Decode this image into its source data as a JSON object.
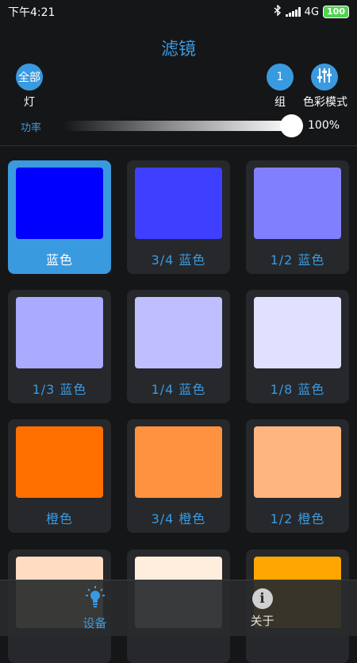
{
  "status_bar": {
    "time": "下午4:21",
    "network": "4G",
    "battery": "100"
  },
  "header": {
    "title": "滤镜"
  },
  "controls": {
    "all_button": "全部",
    "all_label": "灯",
    "group_button": "1",
    "group_label": "组",
    "color_mode_label": "色彩模式"
  },
  "power": {
    "label": "功率",
    "value_text": "100%",
    "level": 1.0
  },
  "filters": [
    {
      "label": "蓝色",
      "color": "#0000ff",
      "selected": true
    },
    {
      "label": "3/4 蓝色",
      "color": "#3f3fff",
      "selected": false
    },
    {
      "label": "1/2 蓝色",
      "color": "#8080ff",
      "selected": false
    },
    {
      "label": "1/3 蓝色",
      "color": "#aaaaff",
      "selected": false
    },
    {
      "label": "1/4 蓝色",
      "color": "#bfbfff",
      "selected": false
    },
    {
      "label": "1/8 蓝色",
      "color": "#e0e0ff",
      "selected": false
    },
    {
      "label": "橙色",
      "color": "#ff6f00",
      "selected": false
    },
    {
      "label": "3/4 橙色",
      "color": "#ff9240",
      "selected": false
    },
    {
      "label": "1/2 橙色",
      "color": "#ffb580",
      "selected": false
    },
    {
      "label": "",
      "color": "#ffdcc2",
      "selected": false
    },
    {
      "label": "",
      "color": "#ffeede",
      "selected": false
    },
    {
      "label": "",
      "color": "#ffa600",
      "selected": false
    }
  ],
  "bottom_nav": {
    "devices": "设备",
    "about": "关于"
  },
  "colors": {
    "accent": "#3a9ae0",
    "background": "#151618",
    "card": "#26282b"
  }
}
